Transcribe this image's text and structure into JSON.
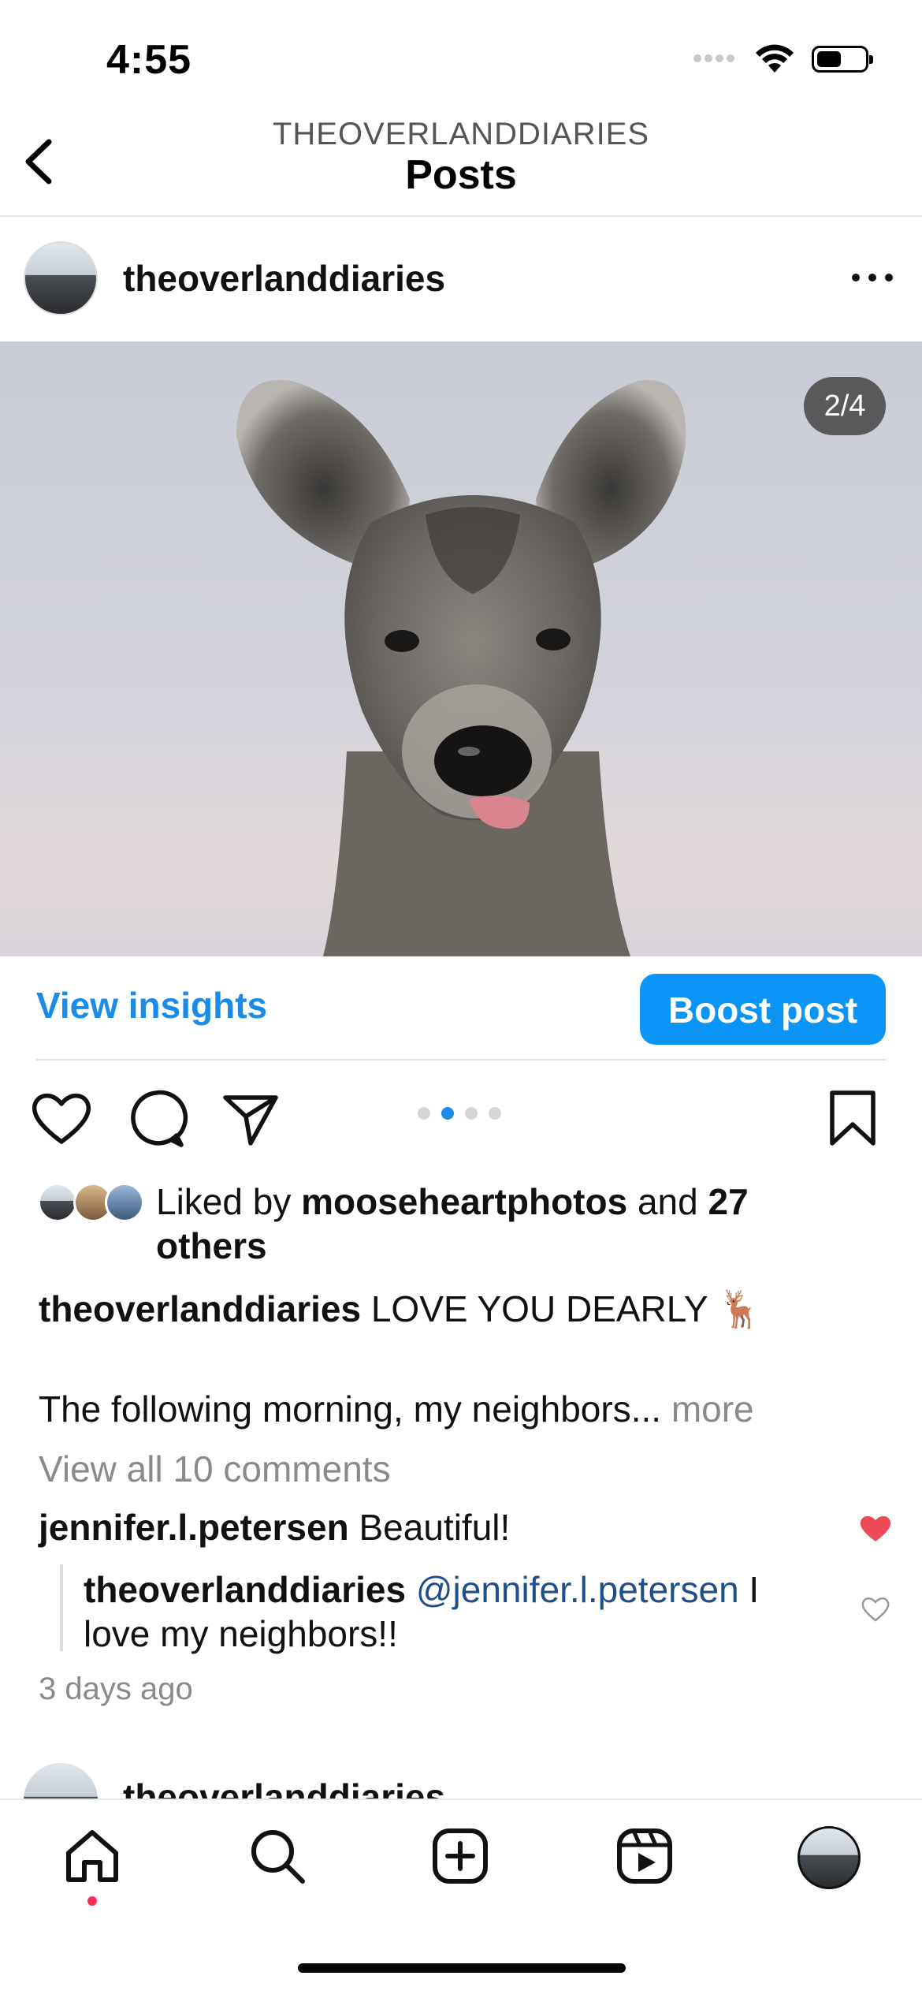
{
  "status_bar": {
    "time": "4:55"
  },
  "header": {
    "account": "THEOVERLANDDIARIES",
    "title": "Posts"
  },
  "post": {
    "username": "theoverlanddiaries",
    "media_counter": "2/4",
    "carousel": {
      "total": 4,
      "active_index": 2
    },
    "actions": {
      "view_insights": "View insights",
      "boost_post": "Boost post"
    },
    "likes": {
      "prefix": "Liked by ",
      "user": "mooseheartphotos",
      "middle": " and ",
      "others": "27 others"
    },
    "caption": {
      "username": "theoverlanddiaries",
      "text": " LOVE YOU DEARLY 🦌",
      "line2": "The following morning, my neighbors... ",
      "more": "more"
    },
    "view_all_comments": "View all 10 comments",
    "comments": [
      {
        "username": "jennifer.l.petersen",
        "text": " Beautiful!",
        "liked": true
      },
      {
        "username": "theoverlanddiaries",
        "mention": "@jennifer.l.petersen",
        "text": "  I love my neighbors!!",
        "liked": false
      }
    ],
    "timestamp": "3 days ago"
  },
  "next_post": {
    "username": "theoverlanddiaries"
  },
  "colors": {
    "accent": "#0a95f6",
    "link": "#1a8ce8",
    "like": "#ed4956",
    "notification": "#ff2d55"
  },
  "nav": [
    "home-icon",
    "search-icon",
    "create-icon",
    "reels-icon",
    "profile-avatar"
  ]
}
